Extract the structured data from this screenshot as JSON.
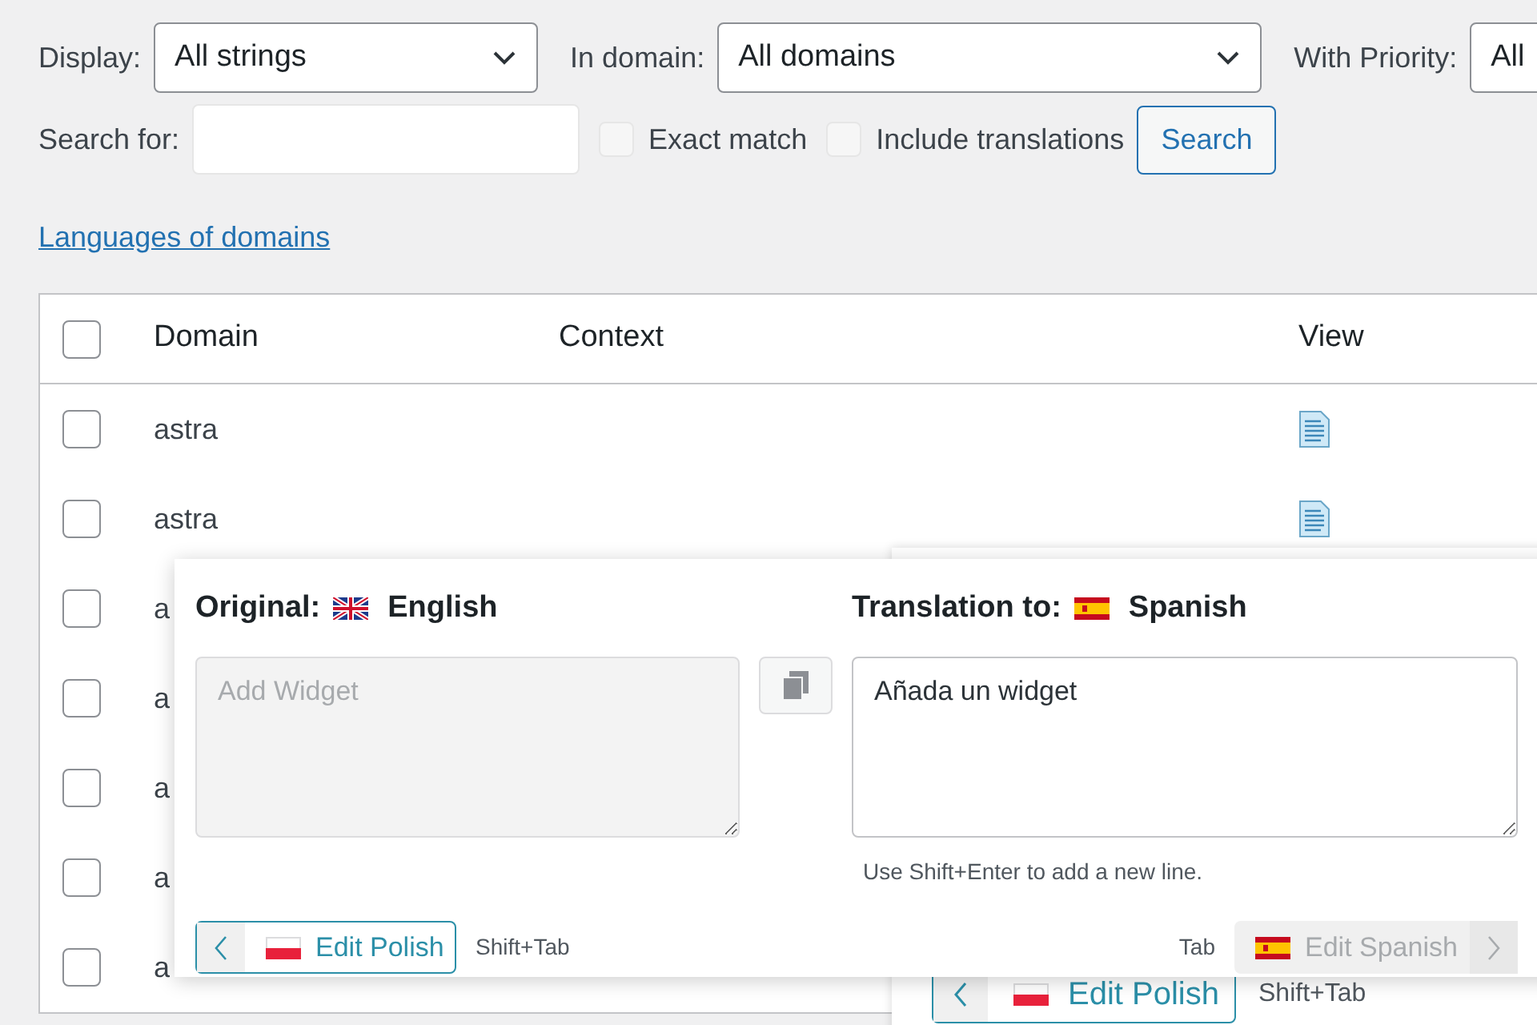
{
  "filters": [
    {
      "label": "Display:",
      "value": "All strings"
    },
    {
      "label": "In domain:",
      "value": "All domains"
    },
    {
      "label": "With Priority:",
      "value": "All"
    }
  ],
  "search": {
    "label": "Search for:",
    "options": [
      {
        "label": "Exact match",
        "checked": false
      },
      {
        "label": "Include translations",
        "checked": false
      }
    ],
    "button": "Search"
  },
  "link": "Languages of domains",
  "table": {
    "select_all": {
      "checked": false
    },
    "columns": [
      "Domain",
      "Context",
      "View"
    ],
    "rows": [
      {
        "domain": "astra",
        "checked": false,
        "view": true
      },
      {
        "domain": "astra",
        "checked": false,
        "view": true
      },
      {
        "domain": "a",
        "checked": false,
        "view": false
      },
      {
        "domain": "a",
        "checked": false,
        "view": false
      },
      {
        "domain": "a",
        "checked": false,
        "view": false
      },
      {
        "domain": "a",
        "checked": false,
        "view": false
      },
      {
        "domain": "a",
        "checked": false,
        "view": false
      }
    ]
  },
  "back_dialog": {
    "prev_button": "Edit Polish",
    "prev_shortcut": "Shift+Tab"
  },
  "dialog": {
    "original_label": "Original:",
    "original_language": "English",
    "translation_label": "Translation to:",
    "translation_language": "Spanish",
    "original_text": "Add Widget",
    "translation_text": "Añada un widget",
    "hint": "Use Shift+Enter to add a new line.",
    "prev_button": "Edit Polish",
    "prev_shortcut": "Shift+Tab",
    "next_shortcut": "Tab",
    "next_button": "Edit Spanish",
    "next_disabled": true
  }
}
